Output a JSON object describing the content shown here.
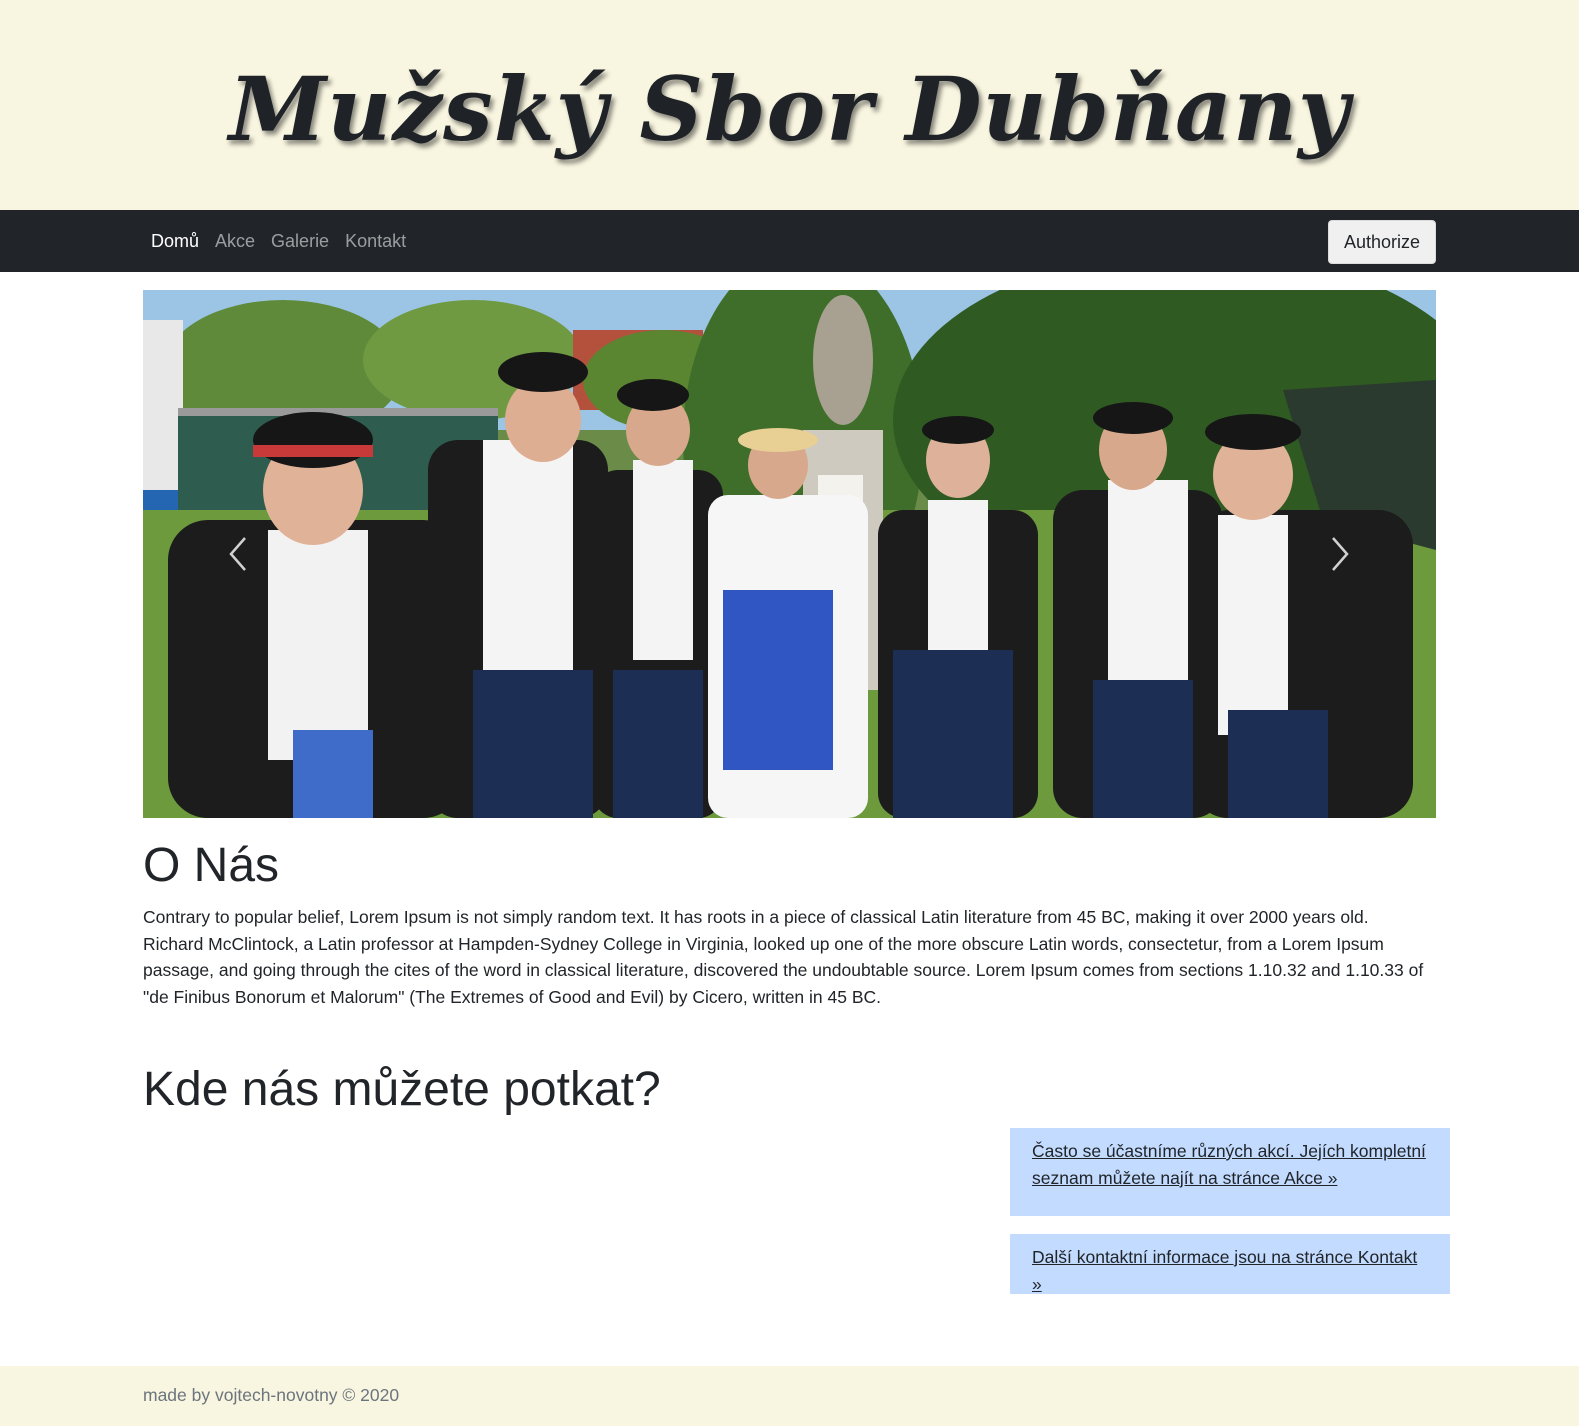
{
  "header": {
    "title": "Mužský Sbor Dubňany"
  },
  "nav": {
    "items": [
      {
        "label": "Domů",
        "active": true
      },
      {
        "label": "Akce",
        "active": false
      },
      {
        "label": "Galerie",
        "active": false
      },
      {
        "label": "Kontakt",
        "active": false
      }
    ],
    "authorize_label": "Authorize"
  },
  "carousel": {
    "prev_icon": "chevron-left-icon",
    "next_icon": "chevron-right-icon"
  },
  "about": {
    "title": "O Nás",
    "text": "Contrary to popular belief, Lorem Ipsum is not simply random text. It has roots in a piece of classical Latin literature from 45 BC, making it over 2000 years old. Richard McClintock, a Latin professor at Hampden-Sydney College in Virginia, looked up one of the more obscure Latin words, consectetur, from a Lorem Ipsum passage, and going through the cites of the word in classical literature, discovered the undoubtable source. Lorem Ipsum comes from sections 1.10.32 and 1.10.33 of \"de Finibus Bonorum et Malorum\" (The Extremes of Good and Evil) by Cicero, written in 45 BC."
  },
  "meet": {
    "title": "Kde nás můžete potkat?",
    "events_link": "Často se účastníme různých akcí. Jejích kompletní seznam můžete najít na stránce Akce »",
    "contact_link": "Další kontaktní informace jsou na stránce Kontakt »"
  },
  "footer": {
    "text": "made by vojtech-novotny © 2020"
  },
  "colors": {
    "header_bg": "#f8f5e0",
    "navbar_bg": "#212529",
    "info_box_bg": "#c2dbff"
  }
}
